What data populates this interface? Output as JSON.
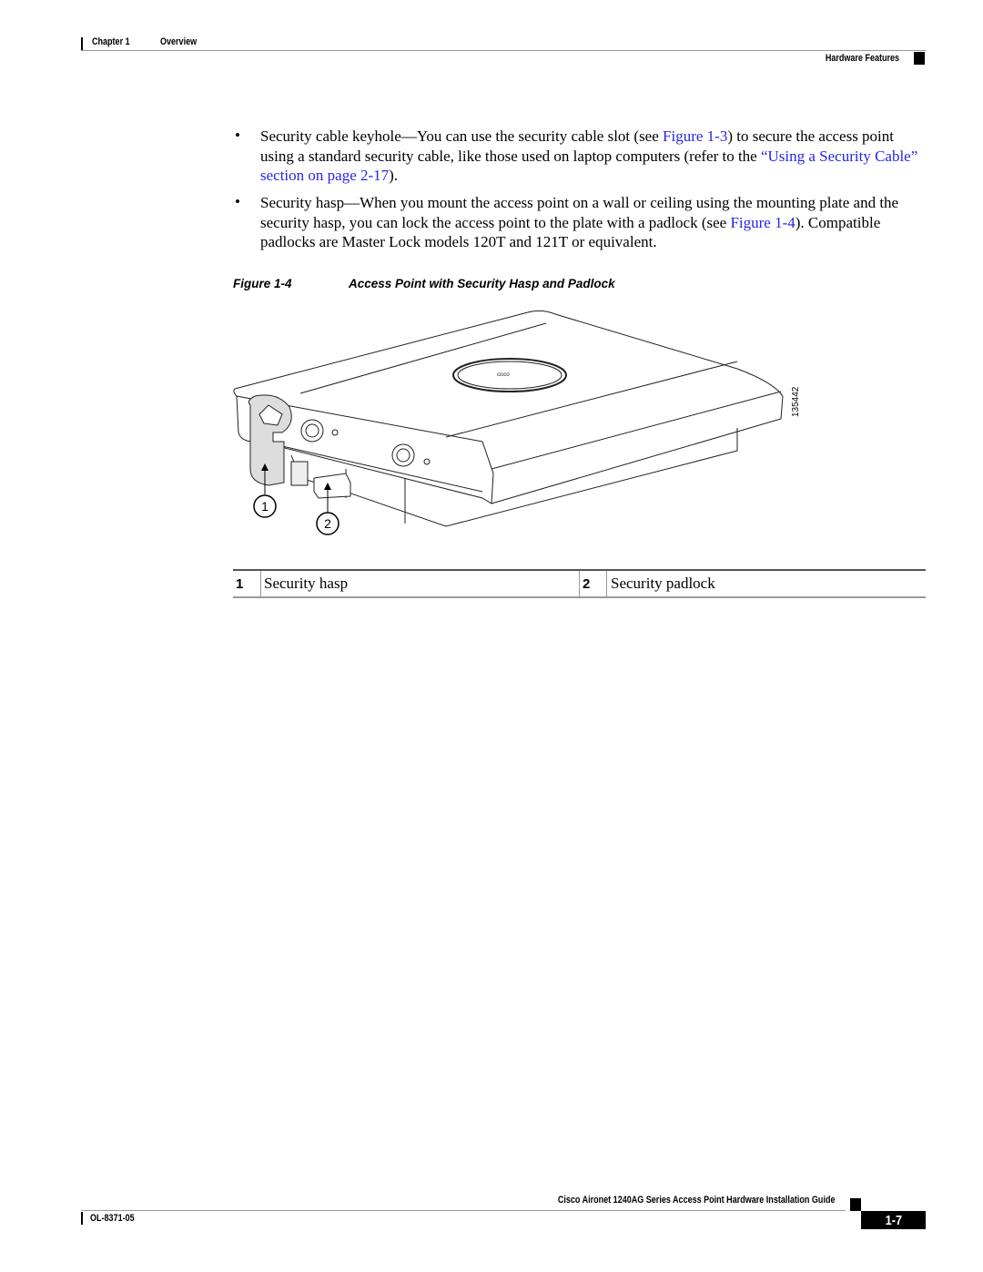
{
  "header": {
    "chapter": "Chapter 1",
    "chapter_title": "Overview",
    "section": "Hardware Features"
  },
  "body": {
    "bullets": [
      {
        "parts": [
          {
            "text": "Security cable keyhole—You can use the security cable slot (see ",
            "link": false
          },
          {
            "text": "Figure 1-3",
            "link": true
          },
          {
            "text": ") to secure the access point using a standard security cable, like those used on laptop computers (refer to the ",
            "link": false
          },
          {
            "text": "“Using a Security Cable” section on page 2-17",
            "link": true
          },
          {
            "text": ").",
            "link": false
          }
        ]
      },
      {
        "parts": [
          {
            "text": "Security hasp—When you mount the access point on a wall or ceiling using the mounting plate and the security hasp, you can lock the access point to the plate with a padlock (see ",
            "link": false
          },
          {
            "text": "Figure 1-4",
            "link": true
          },
          {
            "text": "). Compatible padlocks are Master Lock models 120T and 121T or equivalent.",
            "link": false
          }
        ]
      }
    ],
    "bullet_glyph": "•"
  },
  "figure": {
    "label": "Figure 1-4",
    "title": "Access Point with Security Hasp and Padlock",
    "image_number": "135442",
    "callouts": [
      "1",
      "2"
    ],
    "legend": [
      {
        "num": "1",
        "text": "Security hasp"
      },
      {
        "num": "2",
        "text": "Security padlock"
      }
    ]
  },
  "footer": {
    "guide_title": "Cisco Aironet 1240AG Series Access Point Hardware Installation Guide",
    "doc_number": "OL-8371-05",
    "page_number": "1-7"
  },
  "colors": {
    "link": "#2626e6",
    "text": "#000000"
  }
}
